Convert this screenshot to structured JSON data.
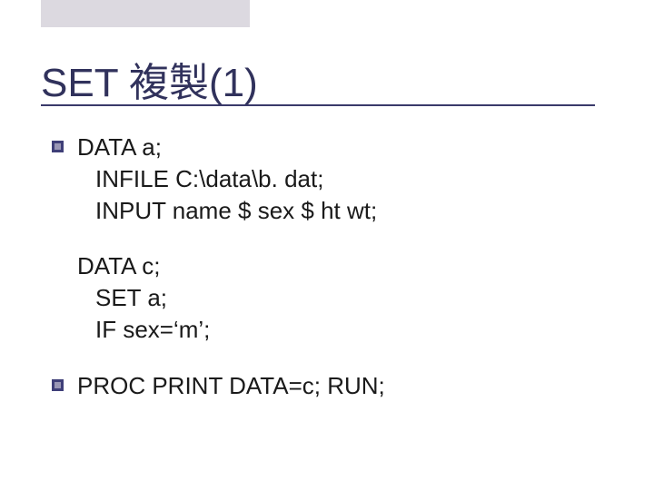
{
  "title": "SET 複製(1)",
  "blocks": [
    {
      "bullet": true,
      "lines": [
        "DATA  a;",
        "INFILE C:\\data\\b. dat;",
        "INPUT name $ sex $ ht wt;"
      ]
    },
    {
      "bullet": false,
      "lines": [
        "DATA c;",
        "SET a;",
        "IF sex=‘m’;"
      ]
    },
    {
      "bullet": true,
      "lines": [
        "PROC PRINT DATA=c; RUN;"
      ]
    }
  ]
}
